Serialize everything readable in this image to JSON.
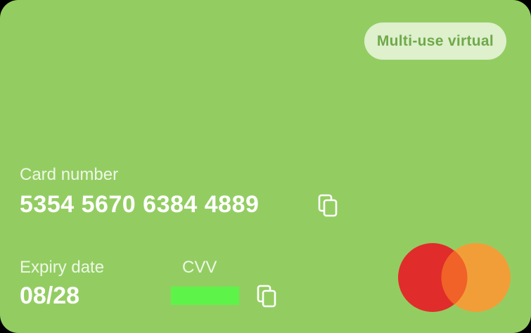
{
  "card": {
    "badge": "Multi-use virtual",
    "card_number_label": "Card number",
    "card_number": "5354 5670 6384 4889",
    "expiry_label": "Expiry date",
    "expiry": "08/28",
    "cvv_label": "CVV"
  },
  "icons": {
    "copy": "copy-icon",
    "brand": "mastercard-logo"
  },
  "colors": {
    "card_background": "#93cd62",
    "badge_background": "#def0cc",
    "badge_text": "#6fa94a",
    "cvv_mask": "#5ef348",
    "mc_red": "#e02c2a",
    "mc_orange": "#f29e38",
    "mc_overlap": "#f06228"
  }
}
